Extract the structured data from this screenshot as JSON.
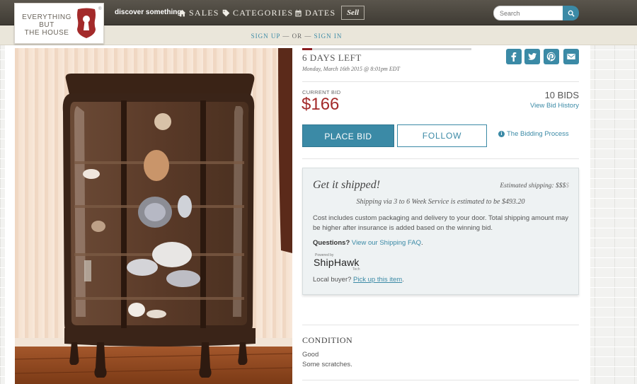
{
  "logo": {
    "text_lines": [
      "EVERYTHING",
      "BUT",
      "THE HOUSE"
    ],
    "mark": "®",
    "color": "#a32a2a"
  },
  "nav": {
    "discover": "discover something",
    "sales": "SALES",
    "categories": "CATEGORIES",
    "dates": "DATES",
    "sell": "Sell",
    "search_placeholder": "Search"
  },
  "auth": {
    "signup": "SIGN UP",
    "or": "— OR —",
    "signin": "SIGN IN"
  },
  "auction": {
    "progress_fraction": 0.06,
    "days_left": "6 DAYS LEFT",
    "end_date": "Monday, March 16th 2015 @ 8:01pm EDT",
    "current_bid_label": "CURRENT BID",
    "current_bid": "$166",
    "bid_count": "10 BIDS",
    "bid_history": "View Bid History",
    "place_bid": "PLACE BID",
    "follow": "FOLLOW",
    "bidding_process": "The Bidding Process"
  },
  "shipping": {
    "title": "Get it shipped!",
    "estimated_label": "Estimated shipping: ",
    "estimated_value": "$$$",
    "estimated_dim": "$",
    "service": "Shipping via 3 to 6 Week Service is estimated to be $493.20",
    "cost_note": "Cost includes custom packaging and delivery to your door. Total shipping amount may be higher after insurance is added based on the winning bid.",
    "questions_label": "Questions?",
    "questions_link": "View our Shipping FAQ",
    "questions_end": ".",
    "powered_by": "Powered by",
    "shiphawk": "ShipHawk",
    "tech": "Tech",
    "local_label": "Local buyer?",
    "local_link": "Pick up this item",
    "local_end": "."
  },
  "condition": {
    "title": "CONDITION",
    "line1": "Good",
    "line2": "Some scratches."
  },
  "colors": {
    "accent": "#3b8aa6",
    "bid_red": "#a32a2a",
    "nav_bg": "#4a463e"
  }
}
